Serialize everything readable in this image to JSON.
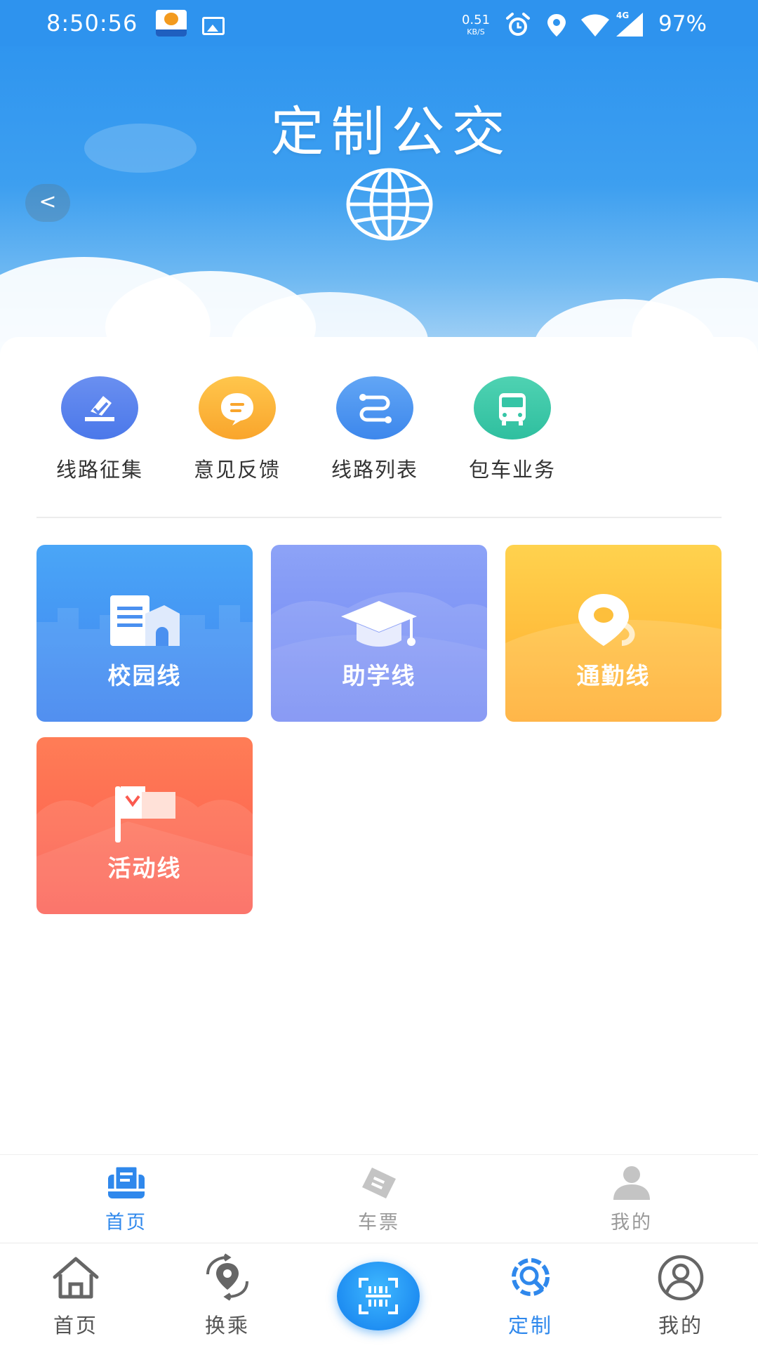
{
  "status_bar": {
    "time": "8:50:56",
    "speed_value": "0.51",
    "speed_unit": "KB/S",
    "network": "4G",
    "battery": "97%",
    "icons": [
      "app-notification-icon",
      "image-icon",
      "alarm-icon",
      "location-icon",
      "wifi-icon",
      "signal-icon"
    ]
  },
  "banner": {
    "title": "定制公交",
    "icon": "globe-icon",
    "prev_label": "<"
  },
  "quick_actions": [
    {
      "label": "线路征集",
      "icon": "collect-icon",
      "color": "#5b86ee"
    },
    {
      "label": "意见反馈",
      "icon": "feedback-icon",
      "color": "#fbb23a"
    },
    {
      "label": "线路列表",
      "icon": "route-icon",
      "color": "#4d95f0"
    },
    {
      "label": "包车业务",
      "icon": "bus-icon",
      "color": "#35c5a6"
    }
  ],
  "route_tiles": [
    {
      "label": "校园线",
      "icon": "school-building-icon"
    },
    {
      "label": "助学线",
      "icon": "graduation-cap-icon"
    },
    {
      "label": "通勤线",
      "icon": "location-pin-icon"
    },
    {
      "label": "活动线",
      "icon": "flag-icon"
    }
  ],
  "inner_tabs": [
    {
      "label": "首页",
      "icon": "home-list-icon",
      "active": true
    },
    {
      "label": "车票",
      "icon": "ticket-icon",
      "active": false
    },
    {
      "label": "我的",
      "icon": "user-icon",
      "active": false
    }
  ],
  "bottom_nav": [
    {
      "label": "首页",
      "icon": "home-icon",
      "active": false
    },
    {
      "label": "换乘",
      "icon": "transfer-icon",
      "active": false
    },
    {
      "label": "",
      "icon": "scan-icon",
      "active": false
    },
    {
      "label": "定制",
      "icon": "custom-icon",
      "active": true
    },
    {
      "label": "我的",
      "icon": "profile-icon",
      "active": false
    }
  ],
  "colors": {
    "primary": "#2f88ec",
    "status_bar": "#2e93ee",
    "inactive": "#999999"
  }
}
